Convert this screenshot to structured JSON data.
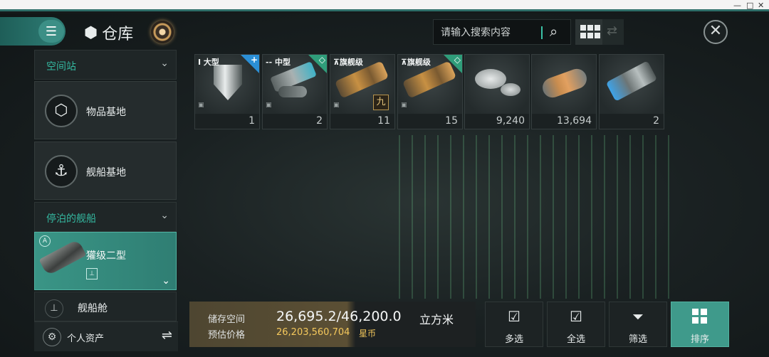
{
  "window": {
    "min": "—",
    "max": "□",
    "close": "✕"
  },
  "header": {
    "title": "仓库",
    "search_placeholder": "请输入搜索内容",
    "icons": {
      "menu": "hamburger-icon",
      "title": "cube-icon",
      "radar": "radar-icon",
      "search": "search-icon",
      "grid": "grid-view-icon",
      "swap": "swap-arrows-icon",
      "close": "close-icon"
    },
    "menu_glyph": "☰",
    "cube_glyph": "⬢",
    "search_glyph": "⌕",
    "swap_glyph": "⇄",
    "close_glyph": "✕"
  },
  "sidebar": {
    "section1": {
      "label": "空间站",
      "chevron": "⌄"
    },
    "item_base": {
      "label": "物品基地",
      "glyph": "⬡"
    },
    "ship_base": {
      "label": "舰船基地",
      "glyph": "⚓"
    },
    "section2": {
      "label": "停泊的舰船",
      "chevron": "⌄"
    },
    "ship": {
      "name": "獾级二型",
      "badge": "A",
      "sub": "⊥",
      "chevron": "⌄"
    },
    "bay": {
      "label": "舰船舱",
      "glyph": "⊥"
    },
    "assets": {
      "label": "个人资产",
      "glyph": "⚙",
      "swap": "⇌"
    }
  },
  "items": [
    {
      "tag": "I  大型",
      "corner": "blue",
      "corner_mark": "+",
      "count": "1",
      "icon": "shield-icon"
    },
    {
      "tag": "--  中型",
      "corner": "green",
      "corner_mark": "◇",
      "count": "2",
      "icon": "turret-icon"
    },
    {
      "tag": "⊼旗舰级",
      "corner": "none",
      "corner_mark": "",
      "level": "九",
      "count": "11",
      "icon": "cannon-icon"
    },
    {
      "tag": "⊼旗舰级",
      "corner": "green",
      "corner_mark": "◇",
      "count": "15",
      "icon": "cannon-icon"
    },
    {
      "tag": "",
      "corner": "none",
      "corner_mark": "",
      "count": "9,240",
      "icon": "coins-icon"
    },
    {
      "tag": "",
      "corner": "none",
      "corner_mark": "",
      "count": "13,694",
      "icon": "capsule-icon"
    },
    {
      "tag": "",
      "corner": "none",
      "corner_mark": "",
      "count": "2",
      "icon": "module-icon"
    }
  ],
  "storage": {
    "space_label": "储存空间",
    "space_value": "26,695.2/46,200.0",
    "space_unit": "立方米",
    "price_label": "预估价格",
    "price_value": "26,203,560,704",
    "price_unit": "星币",
    "fill_fraction": 0.578
  },
  "actions": {
    "multi": {
      "label": "多选",
      "glyph": "☑"
    },
    "all": {
      "label": "全选",
      "glyph": "☑"
    },
    "filter": {
      "label": "筛选",
      "glyph": "⏷"
    },
    "sort": {
      "label": "排序"
    }
  },
  "colors": {
    "accent": "#3f9a8b",
    "section_text": "#34b8a0",
    "gold": "#f4c85c",
    "rarity_blue": "#2b8fd6",
    "rarity_green": "#2f9d7a"
  }
}
